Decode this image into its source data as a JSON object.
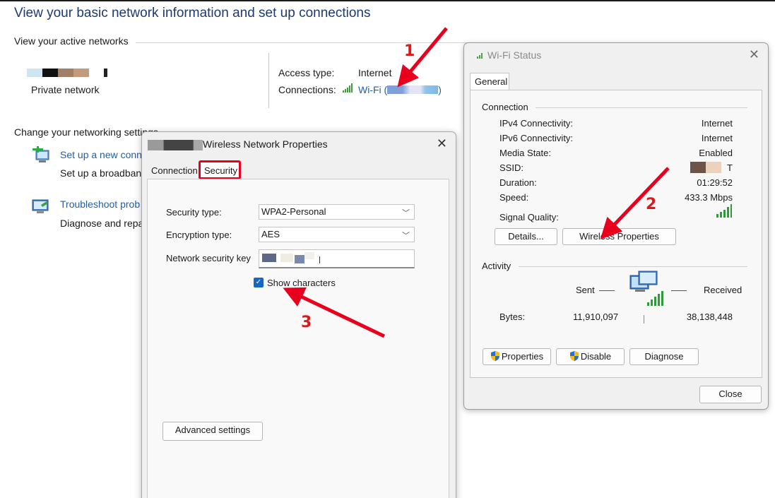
{
  "control_panel": {
    "title": "View your basic network information and set up connections",
    "active_networks_heading": "View your active networks",
    "network_name_label": "Private network",
    "access_type_label": "Access type:",
    "access_type_value": "Internet",
    "connections_label": "Connections:",
    "connections_link": "Wi-Fi (",
    "connections_link_end": ")",
    "change_settings_heading": "Change your networking settings",
    "setup_link": "Set up a new conn",
    "setup_desc": "Set up a broadban",
    "troubleshoot_link": "Troubleshoot prob",
    "troubleshoot_desc": "Diagnose and repa"
  },
  "wifi_status": {
    "title": "Wi-Fi Status",
    "tab_general": "General",
    "connection_group": "Connection",
    "rows": [
      {
        "label": "IPv4 Connectivity:",
        "value": "Internet"
      },
      {
        "label": "IPv6 Connectivity:",
        "value": "Internet"
      },
      {
        "label": "Media State:",
        "value": "Enabled"
      },
      {
        "label": "SSID:",
        "value": "T"
      },
      {
        "label": "Duration:",
        "value": "01:29:52"
      },
      {
        "label": "Speed:",
        "value": "433.3 Mbps"
      }
    ],
    "signal_quality_label": "Signal Quality:",
    "details_button": "Details...",
    "wireless_properties_button": "Wireless Properties",
    "activity_group": "Activity",
    "sent_label": "Sent",
    "received_label": "Received",
    "bytes_label": "Bytes:",
    "bytes_sent": "11,910,097",
    "bytes_received": "38,138,448",
    "properties_button": "Properties",
    "disable_button": "Disable",
    "diagnose_button": "Diagnose",
    "close_button": "Close"
  },
  "wireless_properties": {
    "title": "Wireless Network Properties",
    "tab_connection": "Connection",
    "tab_security": "Security",
    "security_type_label": "Security type:",
    "security_type_value": "WPA2-Personal",
    "encryption_type_label": "Encryption type:",
    "encryption_type_value": "AES",
    "network_key_label": "Network security key",
    "show_characters_label": "Show characters",
    "show_characters_checked": true,
    "advanced_settings_button": "Advanced settings"
  },
  "annotations": {
    "step1": "1",
    "step2": "2",
    "step3": "3",
    "color": "#e8001c"
  },
  "icons": [
    "wifi-signal-icon",
    "close-icon",
    "network-setup-icon",
    "troubleshoot-icon",
    "computer-network-icon",
    "shield-icon",
    "chevron-down-icon",
    "checkbox-icon"
  ]
}
